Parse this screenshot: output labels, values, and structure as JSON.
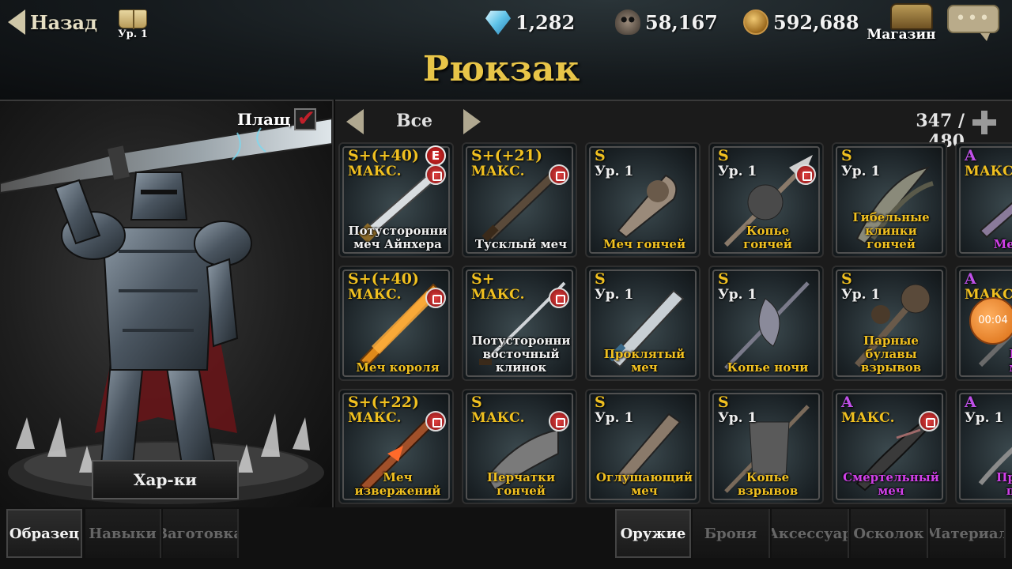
{
  "header": {
    "back_label": "Назад",
    "book_level": "Ур. 1",
    "currencies": [
      {
        "icon": "diamond-icon",
        "value": "1,282"
      },
      {
        "icon": "skull-icon",
        "value": "58,167"
      },
      {
        "icon": "gold-coin-icon",
        "value": "592,688"
      }
    ],
    "shop_label": "Магазин",
    "chat_dots": "•••",
    "title": "Рюкзак"
  },
  "character": {
    "cloak_label": "Плащ",
    "cloak_checked": true,
    "stats_label": "Хар-ки"
  },
  "inventory": {
    "filter_label": "Все",
    "capacity": "347 / 480",
    "items": [
      {
        "grade": "S+(+40)",
        "level": "МАКС.",
        "name": "Потусторонни\nмеч Айнхера",
        "equipped": true,
        "locked": true,
        "grade_color": "gold",
        "name_color": "white"
      },
      {
        "grade": "S+(+21)",
        "level": "МАКС.",
        "name": "Тусклый меч",
        "equipped": false,
        "locked": true,
        "grade_color": "gold",
        "name_color": "white"
      },
      {
        "grade": "S",
        "level": "Ур. 1",
        "name": "Меч гончей",
        "equipped": false,
        "locked": false,
        "grade_color": "gold",
        "name_color": "gold"
      },
      {
        "grade": "S",
        "level": "Ур. 1",
        "name": "Копье\nгончей",
        "equipped": false,
        "locked": true,
        "grade_color": "gold",
        "name_color": "gold"
      },
      {
        "grade": "S",
        "level": "Ур. 1",
        "name": "Гибельные\nклинки\nгончей",
        "equipped": false,
        "locked": false,
        "grade_color": "gold",
        "name_color": "gold"
      },
      {
        "grade": "A",
        "level": "МАКС.",
        "name": "Меч в",
        "equipped": false,
        "locked": false,
        "grade_color": "purple",
        "name_color": "purple"
      },
      {
        "grade": "S+(+40)",
        "level": "МАКС.",
        "name": "Меч короля",
        "equipped": false,
        "locked": true,
        "grade_color": "gold",
        "name_color": "gold"
      },
      {
        "grade": "S+",
        "level": "МАКС.",
        "name": "Потусторонни\nвосточный\nклинок",
        "equipped": false,
        "locked": true,
        "grade_color": "gold",
        "name_color": "white"
      },
      {
        "grade": "S",
        "level": "Ур. 1",
        "name": "Проклятый\nмеч",
        "equipped": false,
        "locked": false,
        "grade_color": "gold",
        "name_color": "gold"
      },
      {
        "grade": "S",
        "level": "Ур. 1",
        "name": "Копье ночи",
        "equipped": false,
        "locked": false,
        "grade_color": "gold",
        "name_color": "gold"
      },
      {
        "grade": "S",
        "level": "Ур. 1",
        "name": "Парные\nбулавы\nвзрывов",
        "equipped": false,
        "locked": false,
        "grade_color": "gold",
        "name_color": "gold"
      },
      {
        "grade": "A",
        "level": "МАКС.",
        "name": "В\nм",
        "equipped": false,
        "locked": false,
        "grade_color": "purple",
        "name_color": "purple",
        "timer": "00:04"
      },
      {
        "grade": "S+(+22)",
        "level": "МАКС.",
        "name": "Меч\nизвержений",
        "equipped": false,
        "locked": true,
        "grade_color": "gold",
        "name_color": "gold"
      },
      {
        "grade": "S",
        "level": "МАКС.",
        "name": "Перчатки\nгончей",
        "equipped": false,
        "locked": true,
        "grade_color": "gold",
        "name_color": "gold"
      },
      {
        "grade": "S",
        "level": "Ур. 1",
        "name": "Оглушающий\nмеч",
        "equipped": false,
        "locked": false,
        "grade_color": "gold",
        "name_color": "gold"
      },
      {
        "grade": "S",
        "level": "Ур. 1",
        "name": "Копье\nвзрывов",
        "equipped": false,
        "locked": false,
        "grade_color": "gold",
        "name_color": "gold"
      },
      {
        "grade": "A",
        "level": "МАКС.",
        "name": "Смертельный\nмеч",
        "equipped": false,
        "locked": true,
        "grade_color": "purple",
        "name_color": "purple"
      },
      {
        "grade": "A",
        "level": "Ур. 1",
        "name": "Прон\nпе",
        "equipped": false,
        "locked": false,
        "grade_color": "purple",
        "name_color": "purple"
      }
    ]
  },
  "left_tabs": [
    {
      "label": "Образец",
      "active": true
    },
    {
      "label": "Навыки",
      "active": false
    },
    {
      "label": "Заготовка",
      "active": false
    }
  ],
  "right_tabs": [
    {
      "label": "Оружие",
      "active": true
    },
    {
      "label": "Броня",
      "active": false
    },
    {
      "label": "Аксессуар",
      "active": false
    },
    {
      "label": "Осколок",
      "active": false
    },
    {
      "label": "Материал",
      "active": false
    }
  ],
  "colors": {
    "gold": "#f0c020",
    "purple": "#d040e8",
    "title": "#e8c548"
  }
}
